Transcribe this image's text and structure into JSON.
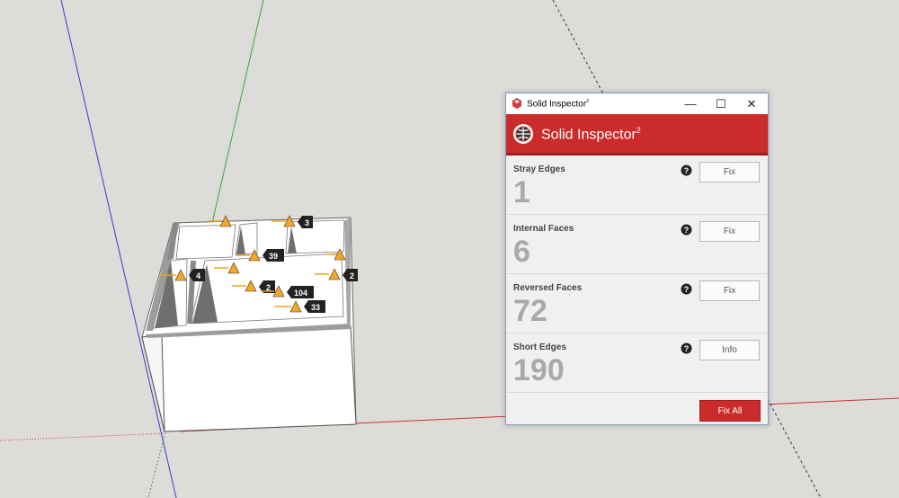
{
  "window": {
    "title": "Solid Inspector",
    "title_sup": "2",
    "minimize_glyph": "—",
    "maximize_glyph": "☐",
    "close_glyph": "✕"
  },
  "header": {
    "title": "Solid Inspector",
    "title_sup": "2",
    "bg_color": "#cc2b2b"
  },
  "sections": [
    {
      "label": "Stray Edges",
      "count": "1",
      "button": "Fix"
    },
    {
      "label": "Internal Faces",
      "count": "6",
      "button": "Fix"
    },
    {
      "label": "Reversed Faces",
      "count": "72",
      "button": "Fix"
    },
    {
      "label": "Short Edges",
      "count": "190",
      "button": "Info"
    }
  ],
  "footer": {
    "fix_all": "Fix All"
  },
  "viewport": {
    "markers": [
      "3",
      "39",
      "4",
      "2",
      "2",
      "104",
      "33"
    ],
    "axis_colors": {
      "red": "#cc3333",
      "green": "#3fa33f",
      "blue": "#3b3bcc"
    }
  }
}
